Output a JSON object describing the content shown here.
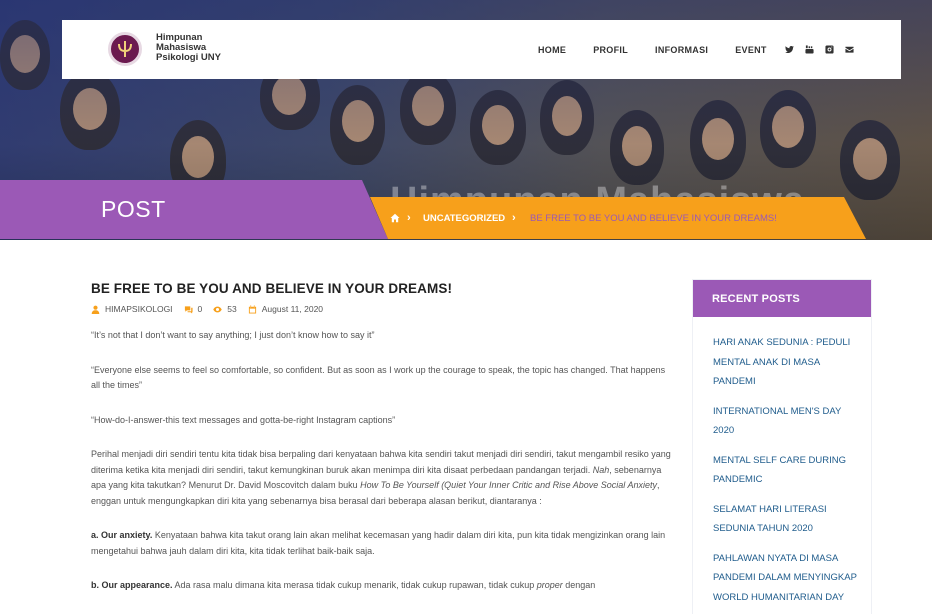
{
  "site": {
    "logo_line1": "Himpunan",
    "logo_line2": "Mahasiswa",
    "logo_line3": "Psikologi UNY"
  },
  "nav": {
    "items": [
      "HOME",
      "PROFIL",
      "INFORMASI",
      "EVENT"
    ],
    "social_icons": [
      "twitter-icon",
      "youtube-icon",
      "instagram-icon",
      "envelope-icon"
    ]
  },
  "hero": {
    "watermark": "Himpunan Mahasiswa"
  },
  "banner": {
    "title": "POST"
  },
  "breadcrumb": {
    "home_icon": "home-icon",
    "category": "UNCATEGORIZED",
    "current": "BE FREE TO BE YOU AND BELIEVE IN YOUR DREAMS!"
  },
  "article": {
    "title": "BE FREE TO BE YOU AND BELIEVE IN YOUR DREAMS!",
    "author": "HIMAPSIKOLOGI",
    "comments": "0",
    "views": "53",
    "date": "August 11, 2020",
    "p1": "“It’s not that I don’t want to say anything; I just don’t know how to say it”",
    "p2": "“Everyone else seems to feel so comfortable, so confident. But as soon as I work up the courage to speak, the topic has changed. That happens all the times”",
    "p3": "“How-do-I-answer-this text messages and gotta-be-right Instagram captions”",
    "p4_a": "Perihal menjadi diri sendiri tentu kita tidak bisa berpaling dari kenyataan bahwa kita sendiri takut menjadi diri sendiri, takut mengambil resiko yang diterima ketika kita menjadi diri sendiri, takut kemungkinan buruk akan menimpa diri kita disaat perbedaan pandangan terjadi. ",
    "p4_nah": "Nah",
    "p4_b": ", sebenarnya apa yang kita takutkan? Menurut Dr. David Moscovitch dalam buku ",
    "p4_book": "How To Be Yourself (Quiet Your Inner Critic and Rise Above Social Anxiety",
    "p4_c": ", enggan untuk mengungkapkan diri kita yang sebenarnya bisa berasal dari beberapa alasan berikut, diantaranya :",
    "p5_label": "a. Our anxiety.",
    "p5_text": " Kenyataan bahwa kita takut orang lain akan melihat kecemasan yang hadir dalam diri kita, pun kita tidak mengizinkan orang lain mengetahui bahwa jauh dalam diri kita, kita tidak terlihat baik-baik saja.",
    "p6_label": "b. Our appearance.",
    "p6_text": " Ada rasa malu dimana kita merasa tidak cukup menarik, tidak cukup rupawan, tidak cukup ",
    "p6_italic": "proper",
    "p6_end": " dengan"
  },
  "sidebar": {
    "heading": "RECENT POSTS",
    "posts": [
      "HARI ANAK SEDUNIA : PEDULI MENTAL ANAK DI MASA PANDEMI",
      "INTERNATIONAL MEN'S DAY 2020",
      "MENTAL SELF CARE DURING PANDEMIC",
      "SELAMAT HARI LITERASI SEDUNIA TAHUN 2020",
      "PAHLAWAN NYATA DI MASA PANDEMI DALAM MENYINGKAP WORLD HUMANITARIAN DAY"
    ]
  },
  "colors": {
    "purple": "#9b59b6",
    "orange": "#f7a01b",
    "link_blue": "#1f5c8c"
  }
}
